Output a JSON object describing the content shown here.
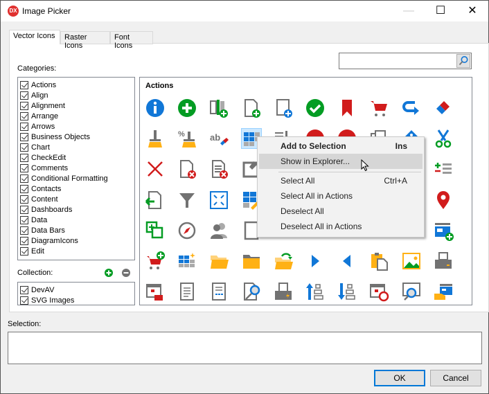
{
  "window": {
    "title": "Image Picker",
    "logo_text": "DX",
    "controls": {
      "minimize": "—",
      "maximize": "☐",
      "close": "✕"
    }
  },
  "tabs": [
    {
      "label": "Vector Icons",
      "active": true
    },
    {
      "label": "Raster Icons",
      "active": false
    },
    {
      "label": "Font Icons",
      "active": false
    }
  ],
  "categories": {
    "label": "Categories:",
    "items": [
      {
        "label": "Actions",
        "checked": true
      },
      {
        "label": "Align",
        "checked": true
      },
      {
        "label": "Alignment",
        "checked": true
      },
      {
        "label": "Arrange",
        "checked": true
      },
      {
        "label": "Arrows",
        "checked": true
      },
      {
        "label": "Business Objects",
        "checked": true
      },
      {
        "label": "Chart",
        "checked": true
      },
      {
        "label": "CheckEdit",
        "checked": true
      },
      {
        "label": "Comments",
        "checked": true
      },
      {
        "label": "Conditional Formatting",
        "checked": true
      },
      {
        "label": "Contacts",
        "checked": true
      },
      {
        "label": "Content",
        "checked": true
      },
      {
        "label": "Dashboards",
        "checked": true
      },
      {
        "label": "Data",
        "checked": true
      },
      {
        "label": "Data Bars",
        "checked": true
      },
      {
        "label": "DiagramIcons",
        "checked": true
      },
      {
        "label": "Edit",
        "checked": true
      }
    ]
  },
  "collection": {
    "label": "Collection:",
    "add_icon": "add-circle-icon",
    "remove_icon": "remove-circle-icon",
    "items": [
      {
        "label": "DevAV",
        "checked": true
      },
      {
        "label": "SVG Images",
        "checked": true
      }
    ]
  },
  "search": {
    "value": "",
    "placeholder": "",
    "icon": "search-icon"
  },
  "gallery": {
    "group_title": "Actions",
    "icons": [
      [
        "info",
        "add",
        "add-column",
        "new-document",
        "new-document-blue",
        "apply",
        "bookmark",
        "add-to-cart",
        "redo",
        "eraser"
      ],
      [
        "clear-formatting",
        "clear-percent",
        "clear-text",
        "clear-table",
        "clear-list",
        "cancel-red",
        "cancel-red-2",
        "copy",
        "tag",
        "cut"
      ],
      [
        "close",
        "delete-document",
        "delete-list",
        "edit",
        "",
        "",
        "",
        "",
        "",
        "add-list"
      ],
      [
        "exit-document",
        "filter",
        "fullscreen",
        "edit-table",
        "",
        "",
        "",
        "",
        "",
        "map-pin"
      ],
      [
        "add-item",
        "compass",
        "group-users",
        "document",
        "",
        "",
        "",
        "",
        "",
        "new-window"
      ],
      [
        "add-to-cart-2",
        "new-table",
        "open-folder",
        "folder",
        "open-folder-refresh",
        "next",
        "previous",
        "paste",
        "picture",
        "print"
      ],
      [
        "delete-schedule",
        "text-document",
        "table-document",
        "search-document",
        "print-lightning",
        "move-up",
        "move-down",
        "schedule-alarm",
        "zoom-view",
        "pay"
      ]
    ],
    "selected": {
      "row": 1,
      "col": 3
    }
  },
  "context_menu": {
    "items": [
      {
        "label": "Add to Selection",
        "shortcut": "Ins",
        "bold": true
      },
      {
        "label": "Show in Explorer...",
        "shortcut": "",
        "highlighted": true
      },
      {
        "label": "Select All",
        "shortcut": "Ctrl+A"
      },
      {
        "label": "Select All in Actions",
        "shortcut": ""
      },
      {
        "label": "Deselect All",
        "shortcut": ""
      },
      {
        "label": "Deselect All in Actions",
        "shortcut": ""
      }
    ]
  },
  "selection": {
    "label": "Selection:",
    "value": ""
  },
  "buttons": {
    "ok": "OK",
    "cancel": "Cancel"
  },
  "colors": {
    "blue": "#1177d7",
    "green": "#039c23",
    "red": "#d11c1c",
    "yellow": "#ffb115",
    "gray": "#727272",
    "accent": "#0078d7"
  }
}
